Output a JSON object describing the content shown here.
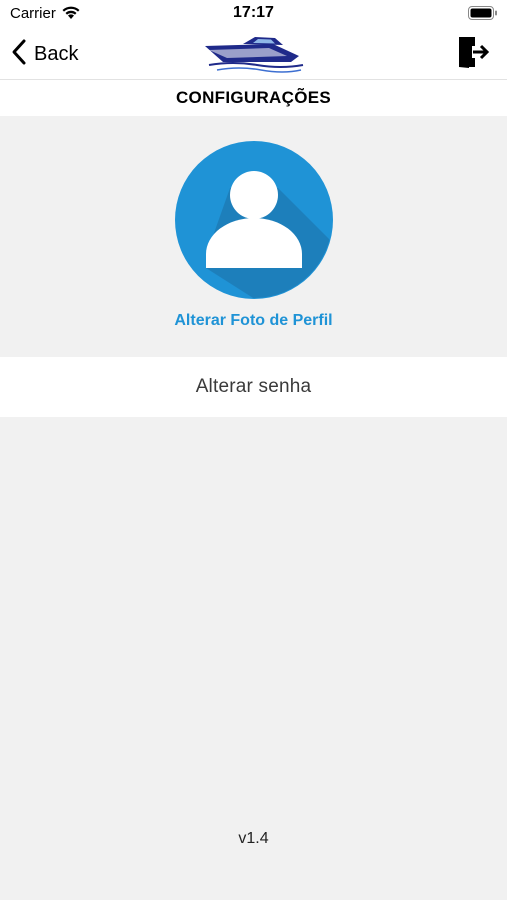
{
  "status_bar": {
    "carrier": "Carrier",
    "time": "17:17"
  },
  "nav": {
    "back_label": "Back",
    "logo_icon": "boat-logo",
    "logout_icon": "exit-door-icon"
  },
  "page": {
    "title": "CONFIGURAÇÕES"
  },
  "profile": {
    "avatar_icon": "user-avatar-icon",
    "change_photo_label": "Alterar Foto de Perfil"
  },
  "settings": {
    "change_password_label": "Alterar senha"
  },
  "footer": {
    "version": "v1.4"
  },
  "colors": {
    "accent": "#1f93d6",
    "avatar_bg": "#1f93d6",
    "avatar_shadow": "#1c6fa6",
    "background": "#f1f1f1",
    "logo_blue": "#1f2a8a"
  }
}
